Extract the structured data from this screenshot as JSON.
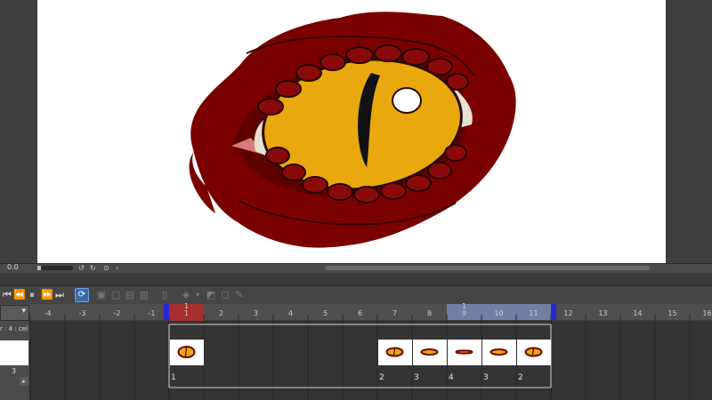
{
  "status_bar": {
    "zoom_value": "0.0",
    "icons": [
      "rotate-left-icon",
      "rotate-right-icon",
      "reset-icon",
      "collapse-icon"
    ]
  },
  "timeline": {
    "toolbar_icons": [
      "first-frame-icon",
      "prev-frame-icon",
      "play-icon",
      "next-frame-icon",
      "last-frame-icon",
      "loop-icon",
      "new-cel-icon",
      "assign-cel-icon",
      "copy-cel-icon",
      "paste-cel-icon",
      "lock-icon",
      "onion-skin-icon",
      "layer-settings-icon",
      "clear-icon",
      "edit-icon"
    ],
    "layer_label": "r : 4 : cel",
    "left_cel_number": "3",
    "playhead_frame": "1",
    "playhead_frame_top": "1",
    "range_marker_frame": "9",
    "range_marker_top": "1",
    "ruler_labels": [
      "-4",
      "-3",
      "-2",
      "-1",
      "1",
      "2",
      "3",
      "4",
      "5",
      "6",
      "7",
      "8",
      "9",
      "10",
      "11",
      "12",
      "13",
      "14",
      "15",
      "16"
    ],
    "cels": [
      {
        "frame": 1,
        "number": "1"
      },
      {
        "frame": 7,
        "number": "2"
      },
      {
        "frame": 8,
        "number": "3"
      },
      {
        "frame": 9,
        "number": "4"
      },
      {
        "frame": 10,
        "number": "3"
      },
      {
        "frame": 11,
        "number": "2"
      }
    ],
    "colors": {
      "playhead": "#b52a2a",
      "range": "#6f7fa6",
      "range_marker": "#2a2ad0"
    }
  }
}
